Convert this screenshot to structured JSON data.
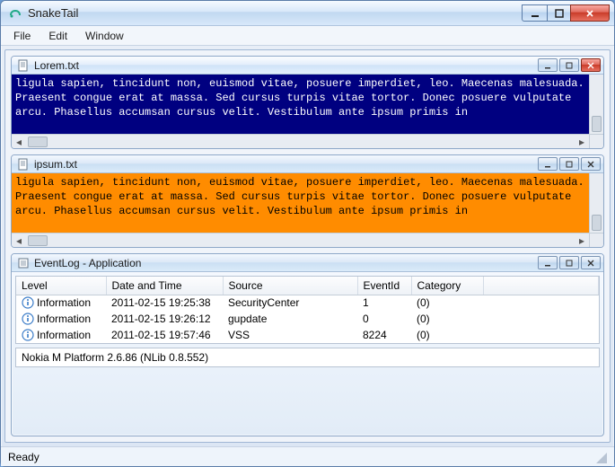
{
  "app": {
    "title": "SnakeTail"
  },
  "menu": {
    "file": "File",
    "edit": "Edit",
    "window": "Window"
  },
  "panes": {
    "lorem": {
      "title": "Lorem.txt",
      "text": "ligula sapien, tincidunt non, euismod vitae, posuere imperdiet, leo. Maecenas malesuada. Praesent congue erat at massa. Sed cursus turpis vitae tortor. Donec posuere vulputate arcu. Phasellus accumsan cursus velit. Vestibulum ante ipsum primis in"
    },
    "ipsum": {
      "title": "ipsum.txt",
      "text": "ligula sapien, tincidunt non, euismod vitae, posuere imperdiet, leo. Maecenas malesuada. Praesent congue erat at massa. Sed cursus turpis vitae tortor. Donec posuere vulputate arcu. Phasellus accumsan cursus velit. Vestibulum ante ipsum primis in"
    },
    "eventlog": {
      "title": "EventLog - Application",
      "columns": {
        "level": "Level",
        "datetime": "Date and Time",
        "source": "Source",
        "eventid": "EventId",
        "category": "Category"
      },
      "rows": [
        {
          "level": "Information",
          "datetime": "2011-02-15 19:25:38",
          "source": "SecurityCenter",
          "eventid": "1",
          "category": "(0)"
        },
        {
          "level": "Information",
          "datetime": "2011-02-15 19:26:12",
          "source": "gupdate",
          "eventid": "0",
          "category": "(0)"
        },
        {
          "level": "Information",
          "datetime": "2011-02-15 19:57:46",
          "source": "VSS",
          "eventid": "8224",
          "category": "(0)"
        }
      ],
      "detail": "Nokia M Platform 2.6.86 (NLib 0.8.552)"
    }
  },
  "status": {
    "text": "Ready"
  }
}
